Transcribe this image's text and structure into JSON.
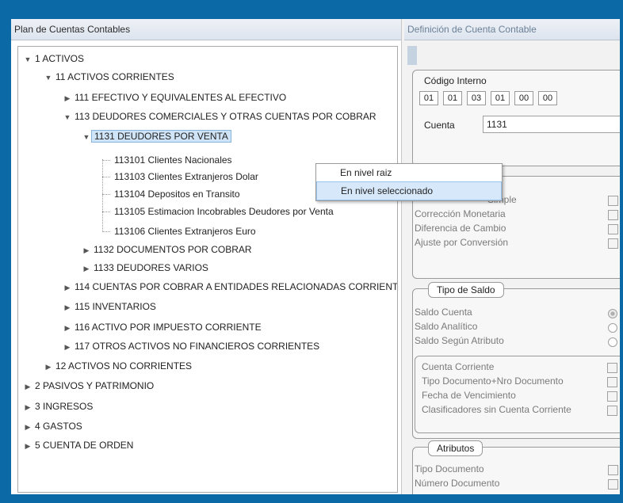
{
  "left_panel": {
    "title": "Plan de Cuentas Contables"
  },
  "tree": {
    "n1": "1 ACTIVOS",
    "n11": "11 ACTIVOS CORRIENTES",
    "n111": "111 EFECTIVO Y EQUIVALENTES AL EFECTIVO",
    "n113": "113 DEUDORES COMERCIALES Y OTRAS CUENTAS POR COBRAR",
    "n1131": "1131 DEUDORES POR VENTA",
    "n113101": "113101 Clientes Nacionales",
    "n113103": "113103 Clientes Extranjeros Dolar",
    "n113104": "113104 Depositos en Transito",
    "n113105": "113105 Estimacion Incobrables Deudores por Venta",
    "n113106": "113106 Clientes Extranjeros Euro",
    "n1132": "1132 DOCUMENTOS POR COBRAR",
    "n1133": "1133 DEUDORES VARIOS",
    "n114": "114 CUENTAS POR COBRAR A ENTIDADES RELACIONADAS CORRIENTES",
    "n115": "115 INVENTARIOS",
    "n116": "116 ACTIVO POR IMPUESTO CORRIENTE",
    "n117": "117 OTROS ACTIVOS NO FINANCIEROS CORRIENTES",
    "n12": "12 ACTIVOS NO CORRIENTES",
    "n2": "2 PASIVOS Y PATRIMONIO",
    "n3": "3 INGRESOS",
    "n4": "4 GASTOS",
    "n5": "5 CUENTA DE ORDEN"
  },
  "context_menu": {
    "item1": "En nivel raiz",
    "item2": "En nivel seleccionado"
  },
  "right_panel": {
    "title": "Definición de Cuenta Contable",
    "codigo_interno_label": "Código Interno",
    "codes": [
      "01",
      "01",
      "03",
      "01",
      "00",
      "00"
    ],
    "cuenta_label": "Cuenta",
    "cuenta_value": "1131",
    "options": {
      "simple": "Simple",
      "correccion": "Corrección Monetaria",
      "diferencia": "Diferencia de Cambio",
      "ajuste": "Ajuste por Conversión"
    },
    "tipo_saldo": {
      "title": "Tipo de Saldo",
      "cuenta": "Saldo Cuenta",
      "analitico": "Saldo Analítico",
      "atributo": "Saldo Según Atributo"
    },
    "saldo_sub": {
      "cc": "Cuenta Corriente",
      "tipo_doc": "Tipo Documento+Nro Documento",
      "fecha": "Fecha de Vencimiento",
      "clasif": "Clasificadores sin Cuenta Corriente"
    },
    "atributos": {
      "title": "Atributos",
      "tipo_doc": "Tipo Documento",
      "numero_doc": "Número Documento"
    }
  },
  "icons": {
    "expanded": "caret-down-icon",
    "collapsed": "caret-right-icon"
  }
}
